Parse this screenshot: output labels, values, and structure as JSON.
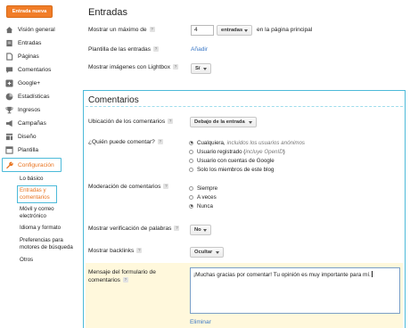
{
  "sidebar": {
    "new_post_label": "Entrada nueva",
    "items": [
      {
        "label": "Visión general",
        "icon": "home-icon"
      },
      {
        "label": "Entradas",
        "icon": "document-icon"
      },
      {
        "label": "Páginas",
        "icon": "page-icon"
      },
      {
        "label": "Comentarios",
        "icon": "comment-icon"
      },
      {
        "label": "Google+",
        "icon": "google-plus-icon"
      },
      {
        "label": "Estadísticas",
        "icon": "stats-icon"
      },
      {
        "label": "Ingresos",
        "icon": "trophy-icon"
      },
      {
        "label": "Campañas",
        "icon": "megaphone-icon"
      },
      {
        "label": "Diseño",
        "icon": "layout-icon"
      },
      {
        "label": "Plantilla",
        "icon": "template-icon"
      },
      {
        "label": "Configuración",
        "icon": "wrench-icon",
        "active": true
      }
    ],
    "sub_items": [
      {
        "label": "Lo básico"
      },
      {
        "label": "Entradas y comentarios",
        "active": true
      },
      {
        "label": "Móvil y correo electrónico"
      },
      {
        "label": "Idioma y formato"
      },
      {
        "label": "Preferencias para motores de búsqueda"
      },
      {
        "label": "Otros"
      }
    ],
    "active_color": "#e8731f"
  },
  "entries": {
    "title": "Entradas",
    "max_label": "Mostrar un máximo de",
    "max_value": "4",
    "max_unit": "entradas",
    "max_suffix": "en la página principal",
    "template_label": "Plantilla de las entradas",
    "template_link": "Añadir",
    "lightbox_label": "Mostrar imágenes con Lightbox",
    "lightbox_value": "Sí"
  },
  "comments": {
    "title": "Comentarios",
    "location_label": "Ubicación de los comentarios",
    "location_value": "Debajo de la entrada",
    "who_label": "¿Quién puede comentar?",
    "who_options": [
      {
        "label": "Cualquiera,",
        "hint": "incluidos los usuarios anónimos",
        "selected": true
      },
      {
        "label": "Usuario registrado",
        "hint_prefix": "(",
        "hint": "incluye OpenID",
        "hint_suffix": ")",
        "selected": false
      },
      {
        "label": "Usuario con cuentas de Google",
        "selected": false
      },
      {
        "label": "Solo los miembros de este blog",
        "selected": false
      }
    ],
    "moderation_label": "Moderación de comentarios",
    "moderation_options": [
      {
        "label": "Siempre",
        "selected": false
      },
      {
        "label": "A veces",
        "selected": false
      },
      {
        "label": "Nunca",
        "selected": true
      }
    ],
    "word_verif_label": "Mostrar verificación de palabras",
    "word_verif_value": "No",
    "backlinks_label": "Mostrar backlinks",
    "backlinks_value": "Ocultar",
    "form_message_label": "Mensaje del formulario de comentarios",
    "form_message_value": "¡Muchas gracias por comentar! Tu opinión es muy importante para mí.",
    "delete_link": "Eliminar"
  },
  "colors": {
    "accent_orange": "#f17d28",
    "highlight_cyan": "#4cbad9",
    "link_blue": "#3b78c6"
  }
}
